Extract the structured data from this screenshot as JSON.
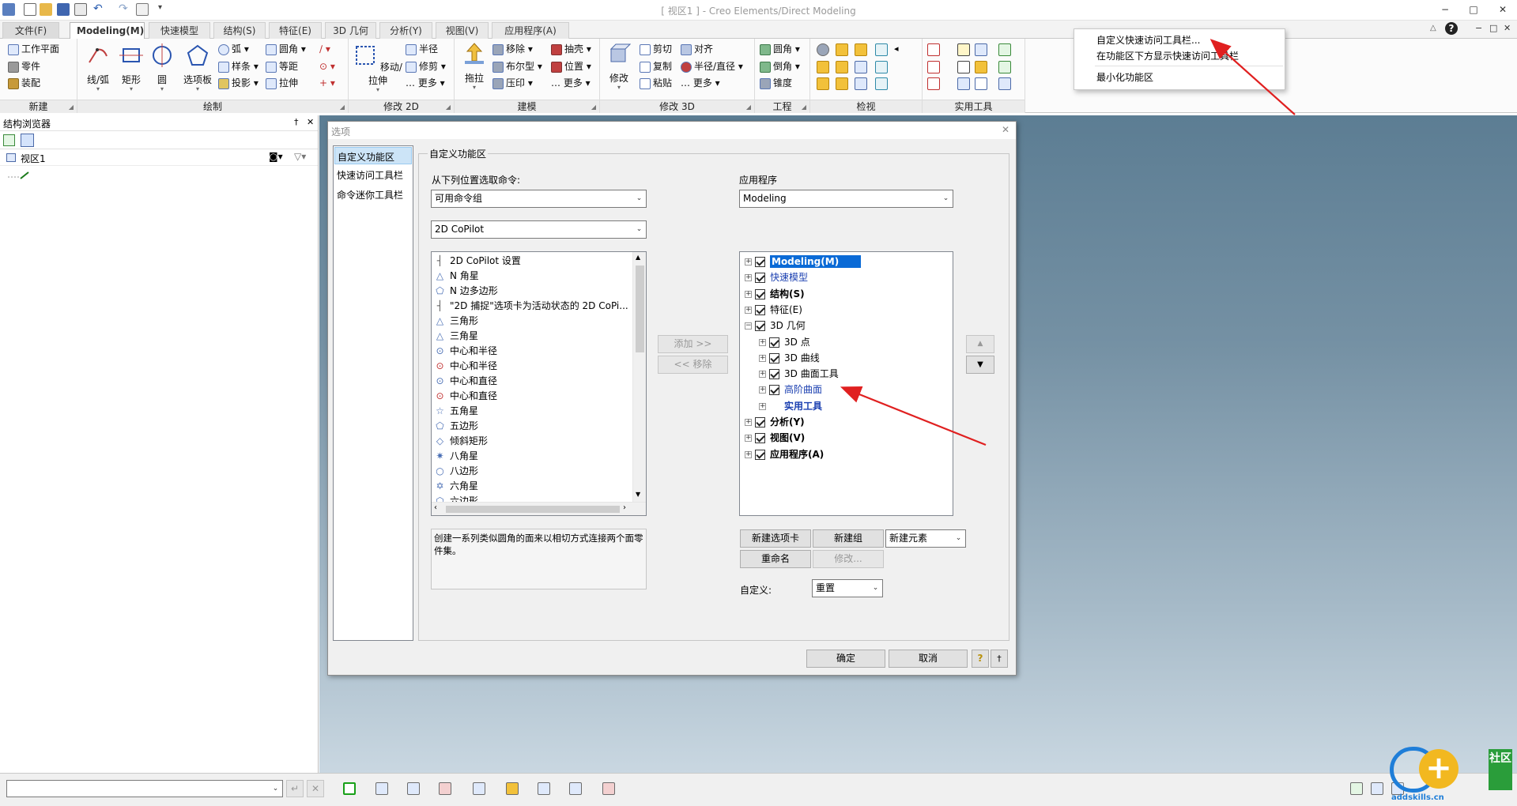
{
  "window": {
    "title": "[ 视区1 ] - Creo Elements/Direct Modeling",
    "min": "−",
    "max": "□",
    "close": "✕",
    "help": "?"
  },
  "tabs": [
    {
      "label": "文件(F)"
    },
    {
      "label": "Modeling(M)"
    },
    {
      "label": "快速模型"
    },
    {
      "label": "结构(S)"
    },
    {
      "label": "特征(E)"
    },
    {
      "label": "3D 几何"
    },
    {
      "label": "分析(Y)"
    },
    {
      "label": "视图(V)"
    },
    {
      "label": "应用程序(A)"
    }
  ],
  "ribbon": {
    "new_group": {
      "label": "新建",
      "items": [
        "工作平面",
        "零件",
        "装配"
      ]
    },
    "draw_group": {
      "label": "绘制",
      "big": [
        "线/弧",
        "矩形",
        "圆",
        "选项板"
      ],
      "small": [
        "弧",
        "样条",
        "投影",
        "圆角",
        "等距",
        "拉伸"
      ]
    },
    "modify2d_group": {
      "label": "修改 2D",
      "big": "移动/拉伸",
      "small": [
        "半径",
        "修剪",
        "更多"
      ]
    },
    "build_group": {
      "label": "建模",
      "big": "拖拉",
      "small": [
        "移除",
        "布尔型",
        "压印",
        "抽壳",
        "位置",
        "更多"
      ]
    },
    "modify3d_group": {
      "label": "修改 3D",
      "big": "修改",
      "small": [
        "剪切",
        "复制",
        "粘贴",
        "对齐",
        "半径/直径",
        "更多"
      ]
    },
    "engineering_group": {
      "label": "工程",
      "small": [
        "圆角",
        "倒角",
        "锥度"
      ]
    },
    "inspect_group": {
      "label": "检视"
    },
    "utility_group": {
      "label": "实用工具"
    }
  },
  "left_panel": {
    "title": "结构浏览器",
    "pin": "†",
    "close": "✕",
    "tree_root": "视区1"
  },
  "dialog": {
    "title": "选项",
    "close": "✕",
    "nav": [
      "自定义功能区",
      "快速访问工具栏",
      "命令迷你工具栏"
    ],
    "section_title": "自定义功能区",
    "choose_from_label": "从下列位置选取命令:",
    "choose_from_value": "可用命令组",
    "group_value": "2D CoPilot",
    "commands": [
      "2D CoPilot 设置",
      "N 角星",
      "N 边多边形",
      "\"2D 捕捉\"选项卡为活动状态的 2D CoPi...",
      "三角形",
      "三角星",
      "中心和半径",
      "中心和半径",
      "中心和直径",
      "中心和直径",
      "五角星",
      "五边形",
      "倾斜矩形",
      "八角星",
      "八边形",
      "六角星",
      "六边形"
    ],
    "add_btn": "添加 >>",
    "remove_btn": "<< 移除",
    "application_label": "应用程序",
    "application_value": "Modeling",
    "tree": [
      {
        "label": "Modeling(M)",
        "level": 0,
        "selected": true,
        "bold": true
      },
      {
        "label": "快速模型",
        "level": 0,
        "blue": true
      },
      {
        "label": "结构(S)",
        "level": 0,
        "bold": true
      },
      {
        "label": "特征(E)",
        "level": 0
      },
      {
        "label": "3D 几何",
        "level": 0,
        "expanded": true
      },
      {
        "label": "3D 点",
        "level": 1
      },
      {
        "label": "3D 曲线",
        "level": 1
      },
      {
        "label": "3D 曲面工具",
        "level": 1
      },
      {
        "label": "高阶曲面",
        "level": 1,
        "blue": true
      },
      {
        "label": "实用工具",
        "level": 1,
        "nocheck": true,
        "bold": true,
        "blue": true
      },
      {
        "label": "分析(Y)",
        "level": 0,
        "bold": true
      },
      {
        "label": "视图(V)",
        "level": 0,
        "bold": true
      },
      {
        "label": "应用程序(A)",
        "level": 0,
        "bold": true
      }
    ],
    "up": "▲",
    "down": "▼",
    "description": "创建一系列类似圆角的面来以相切方式连接两个面零件集。",
    "new_tab_btn": "新建选项卡",
    "new_group_btn": "新建组",
    "new_element_value": "新建元素",
    "rename_btn": "重命名",
    "modify_btn": "修改...",
    "customize_label": "自定义:",
    "reset_value": "重置",
    "ok_btn": "确定",
    "cancel_btn": "取消"
  },
  "context_menu": {
    "items": [
      "自定义快速访问工具栏...",
      "在功能区下方显示快速访问工具栏",
      "最小化功能区"
    ]
  },
  "watermark": {
    "text": "社区",
    "url": "addskills.cn"
  },
  "colors": {
    "accent": "#0a64c8",
    "annotation_arrow": "#e02020",
    "viewport_top": "#5c7d93",
    "viewport_bottom": "#c9d7e1",
    "selection": "#0a6ad6"
  }
}
